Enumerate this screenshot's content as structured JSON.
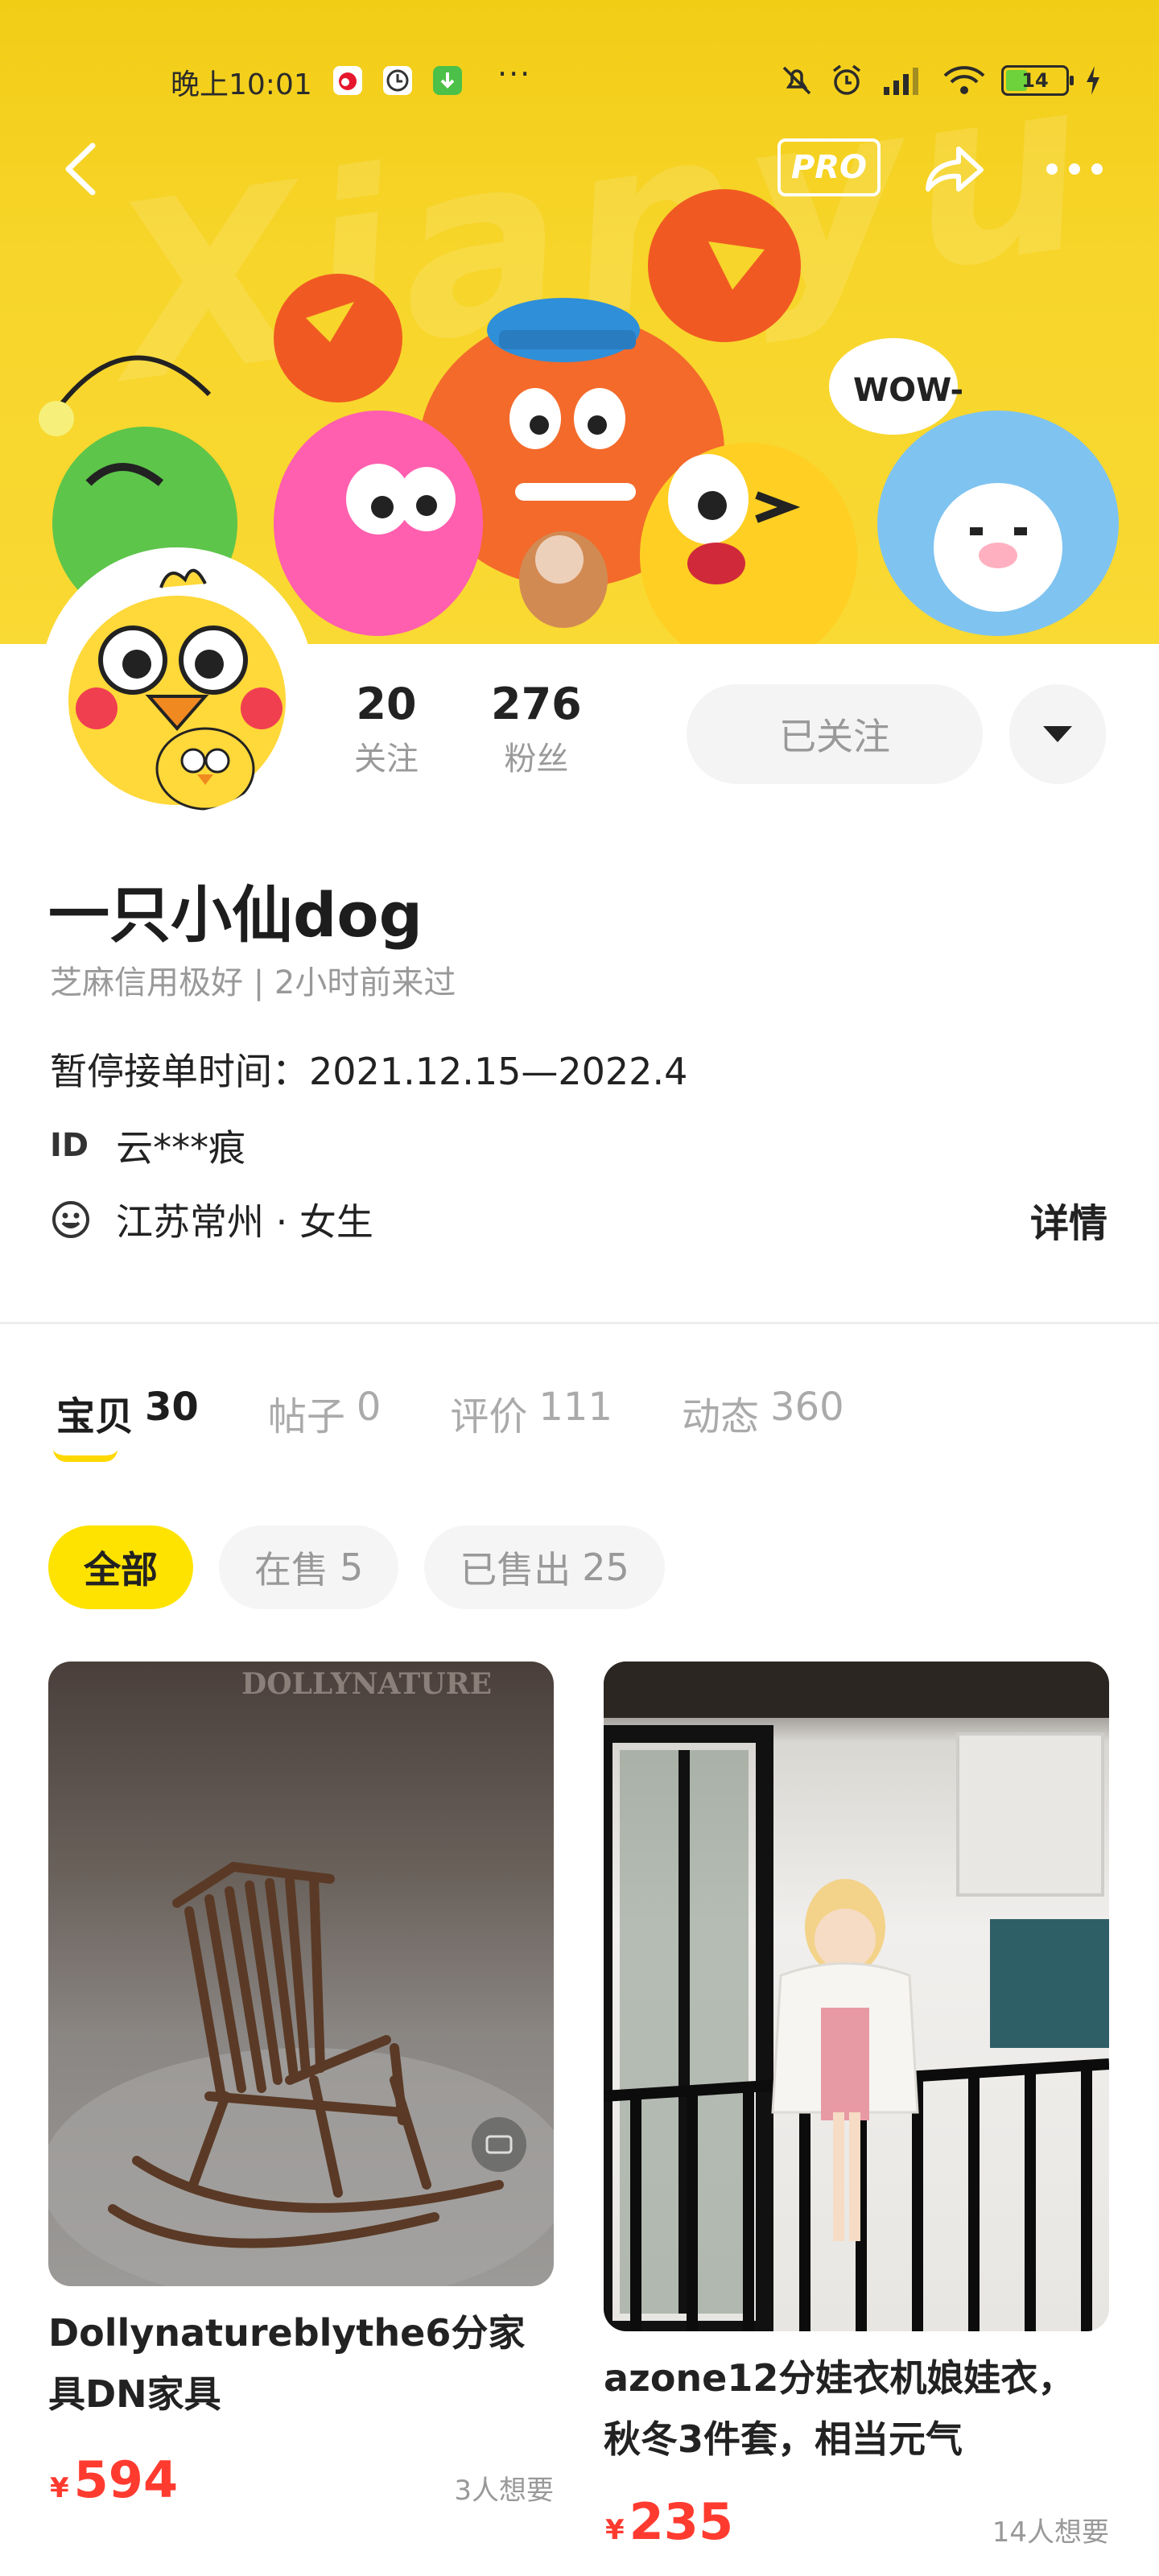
{
  "status_bar": {
    "time": "晚上10:01",
    "dots": "···",
    "battery": "14"
  },
  "nav": {
    "pro_label": "PRO"
  },
  "banner": {
    "bubble_text": "WOW-"
  },
  "profile": {
    "following_count": "20",
    "following_label": "关注",
    "fans_count": "276",
    "fans_label": "粉丝",
    "follow_button": "已关注",
    "name": "一只小仙dog",
    "credit": "芝麻信用极好 | 2小时前来过",
    "pause_notice": "暂停接单时间：2021.12.15—2022.4",
    "id_label": "ID",
    "id_value": "云***痕",
    "location": "江苏常州 · 女生",
    "detail_link": "详情"
  },
  "tabs": [
    {
      "label": "宝贝",
      "count": "30"
    },
    {
      "label": "帖子",
      "count": "0"
    },
    {
      "label": "评价",
      "count": "111"
    },
    {
      "label": "动态",
      "count": "360"
    }
  ],
  "filters": [
    {
      "label": "全部",
      "count": ""
    },
    {
      "label": "在售",
      "count": "5"
    },
    {
      "label": "已售出",
      "count": "25"
    }
  ],
  "products": [
    {
      "watermark": "DOLLYNATURE",
      "title": "Dollynatureblythe6分家具DN家具",
      "currency": "¥",
      "price": "594",
      "wants": "3人想要"
    },
    {
      "title": "azone12分娃衣机娘娃衣，秋冬3件套，相当元气",
      "currency": "¥",
      "price": "235",
      "wants": "14人想要"
    }
  ],
  "colors": {
    "accent_yellow": "#ffe300",
    "banner_yellow": "#f7d52a",
    "price_red": "#ff3b30"
  }
}
